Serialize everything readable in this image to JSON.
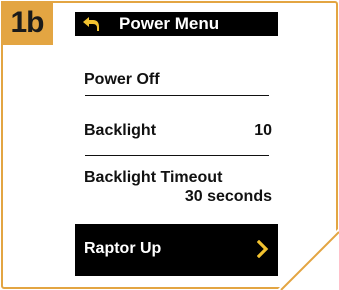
{
  "step": {
    "label": "1b"
  },
  "colors": {
    "accent": "#e3a542",
    "screen_bg": "#ffffff",
    "bar_bg": "#000000",
    "highlight_icon": "#f2c230"
  },
  "screen": {
    "title": "Power Menu",
    "back_icon": "back-arrow-icon",
    "items": [
      {
        "label": "Power Off",
        "value": ""
      },
      {
        "label": "Backlight",
        "value": "10"
      },
      {
        "label": "Backlight Timeout",
        "value": "30 seconds"
      },
      {
        "label": "Raptor Up",
        "value": "",
        "icon": "chevron-right-icon",
        "selected": true
      }
    ]
  }
}
